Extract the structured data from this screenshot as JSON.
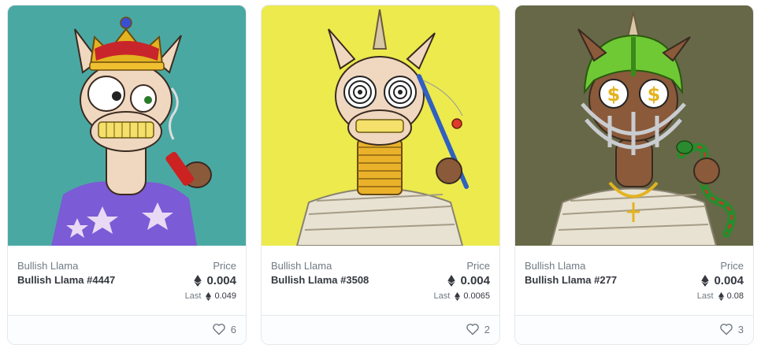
{
  "cards": [
    {
      "collection": "Bullish Llama",
      "name": "Bullish Llama #4447",
      "price_label": "Price",
      "price": "0.004",
      "last_label": "Last",
      "last_price": "0.049",
      "likes": "6",
      "bg_color": "#4aa8a3"
    },
    {
      "collection": "Bullish Llama",
      "name": "Bullish Llama #3508",
      "price_label": "Price",
      "price": "0.004",
      "last_label": "Last",
      "last_price": "0.0065",
      "likes": "2",
      "bg_color": "#ecea4c"
    },
    {
      "collection": "Bullish Llama",
      "name": "Bullish Llama #277",
      "price_label": "Price",
      "price": "0.004",
      "last_label": "Last",
      "last_price": "0.08",
      "likes": "3",
      "bg_color": "#676847"
    }
  ],
  "icons": {
    "currency": "ethereum-icon",
    "like": "heart-outline-icon"
  }
}
